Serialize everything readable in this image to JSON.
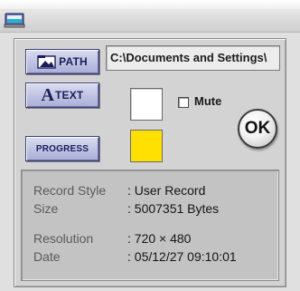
{
  "buttons": {
    "path": "PATH",
    "text_big": "A",
    "text": "TEXT",
    "progress": "PROGRESS",
    "ok": "OK"
  },
  "path_field": {
    "value": "C:\\Documents and Settings\\"
  },
  "mute": {
    "label": "Mute",
    "checked": false
  },
  "colors": {
    "text_color": "#ffffff",
    "progress_color": "#ffe000",
    "button_accent": "#3c3f7a"
  },
  "icons": {
    "app": "computer-window-icon",
    "path": "folder-image-icon",
    "text": "letter-a-icon"
  },
  "info": {
    "record_style": {
      "label": "Record Style",
      "value": ": User Record"
    },
    "size": {
      "label": "Size",
      "value": ": 5007351 Bytes"
    },
    "resolution": {
      "label": "Resolution",
      "value": ": 720 × 480"
    },
    "date": {
      "label": "Date",
      "value": ": 05/12/27  09:10:01"
    }
  }
}
